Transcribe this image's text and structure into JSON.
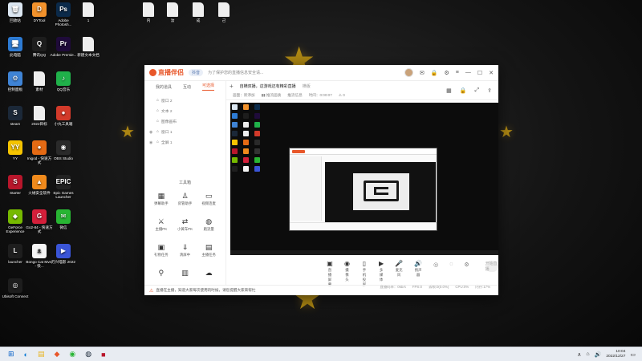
{
  "desktop": {
    "icons": [
      {
        "label": "回收站",
        "glyph": "🗑",
        "color": "#dce7f2"
      },
      {
        "label": "DYTool",
        "glyph": "D",
        "color": "#f2922c"
      },
      {
        "label": "Adobe Photosh...",
        "glyph": "Ps",
        "color": "#0b2a4a"
      },
      {
        "label": "1",
        "glyph": "",
        "color": "#eeeeee"
      },
      {
        "label": "此电脑",
        "glyph": "🖥",
        "color": "#2d7bd4"
      },
      {
        "label": "腾讯QQ",
        "glyph": "Q",
        "color": "#1d1d1d"
      },
      {
        "label": "Adobe Premie...",
        "glyph": "Pr",
        "color": "#1f0b3a"
      },
      {
        "label": "新建文本文档",
        "glyph": "",
        "color": "#eeeeee"
      },
      {
        "label": "控制面板",
        "glyph": "⚙",
        "color": "#3f84d6"
      },
      {
        "label": "素材",
        "glyph": "",
        "color": "#eeeeee"
      },
      {
        "label": "QQ音乐",
        "glyph": "♪",
        "color": "#20b14a"
      },
      {
        "label": "steam",
        "glyph": "S",
        "color": "#1b2838"
      },
      {
        "label": "2022目标",
        "glyph": "",
        "color": "#eeeeee"
      },
      {
        "label": "小丸工具箱",
        "glyph": "●",
        "color": "#d23a2a"
      },
      {
        "label": "YY",
        "glyph": "YY",
        "color": "#f5c400"
      },
      {
        "label": "Inigod - 快速方式",
        "glyph": "●",
        "color": "#e56a14"
      },
      {
        "label": "OBS Studio",
        "glyph": "◉",
        "color": "#2a2a2a"
      },
      {
        "label": "Starter",
        "glyph": "S",
        "color": "#b8162b"
      },
      {
        "label": "火绒安全软件",
        "glyph": "▲",
        "color": "#f08a1c"
      },
      {
        "label": "Epic Games Launcher",
        "glyph": "EPIC",
        "color": "#222222"
      },
      {
        "label": "GeForce Experience",
        "glyph": "◆",
        "color": "#76b900"
      },
      {
        "label": "Go2-84 - 快速方式",
        "glyph": "G",
        "color": "#d41f3a"
      },
      {
        "label": "微信",
        "glyph": "✉",
        "color": "#28b533"
      },
      {
        "label": "launcher",
        "glyph": "L",
        "color": "#1e1e1e"
      },
      {
        "label": "Bongo Cat Mver - 快...",
        "glyph": "ᴥ",
        "color": "#f5f5f5"
      },
      {
        "label": "万兴喵影 2022",
        "glyph": "▶",
        "color": "#3a55d8"
      },
      {
        "label": "Ubisoft Connect",
        "glyph": "◎",
        "color": "#1d1d1d"
      }
    ],
    "top_files": [
      {
        "label": "内"
      },
      {
        "label": "汝"
      },
      {
        "label": "成"
      },
      {
        "label": "己"
      }
    ]
  },
  "app": {
    "title_brand": "直播伴侣",
    "chip": "抖音",
    "notice": "为了保护您的直播信息安全请...",
    "left_tabs": [
      "我的道具",
      "互动",
      "可选择"
    ],
    "sources": [
      {
        "name": "窗口 2"
      },
      {
        "name": "文本 2"
      },
      {
        "name": "图像画布"
      },
      {
        "name": "窗口 1"
      },
      {
        "name": "全屏 1"
      }
    ],
    "tools_title": "工具箱",
    "tools": [
      {
        "label": "弹幕助手",
        "glyph": "▦"
      },
      {
        "label": "房管助手",
        "glyph": "♙"
      },
      {
        "label": "视频连麦",
        "glyph": "▭"
      },
      {
        "label": "主播PK",
        "glyph": "⚔"
      },
      {
        "label": "小黄车PK",
        "glyph": "⇄"
      },
      {
        "label": "跑流量",
        "glyph": "◍"
      },
      {
        "label": "礼物任务",
        "glyph": "▣"
      },
      {
        "label": "清屏中",
        "glyph": "⇓"
      },
      {
        "label": "主播任务",
        "glyph": "▤"
      },
      {
        "label": "",
        "glyph": "⚲"
      },
      {
        "label": "",
        "glyph": "▥"
      },
      {
        "label": "",
        "glyph": "☁"
      }
    ],
    "scene_tabs": {
      "current": "自横双播，这游戏还有精彩直播",
      "other": "横版"
    },
    "meta": [
      "画面：新添加",
      "▮▮ 推流画质",
      "推流信息",
      "时间：0:00:07",
      "⚠ 0"
    ],
    "controls": [
      {
        "label": "直播屏幕",
        "glyph": "▣"
      },
      {
        "label": "摄像头",
        "glyph": "◉"
      },
      {
        "label": "手机投屏",
        "glyph": "▯"
      },
      {
        "label": "多媒体",
        "glyph": "▶"
      },
      {
        "label": "麦克风",
        "glyph": "🎤"
      },
      {
        "label": "扬声器",
        "glyph": "🔊"
      }
    ],
    "start_live": "开始直播",
    "status_right": [
      "直播码率：0kb/s",
      "FPS:0",
      "丢帧:0(0.0%)",
      "CPU:0%",
      "内存:17%"
    ],
    "status_notice": "直播在主播，知道大家每次使用的时候，请您提醒大家来帮忙"
  },
  "taskbar": {
    "time": "10:04",
    "date": "2022/12/27"
  }
}
